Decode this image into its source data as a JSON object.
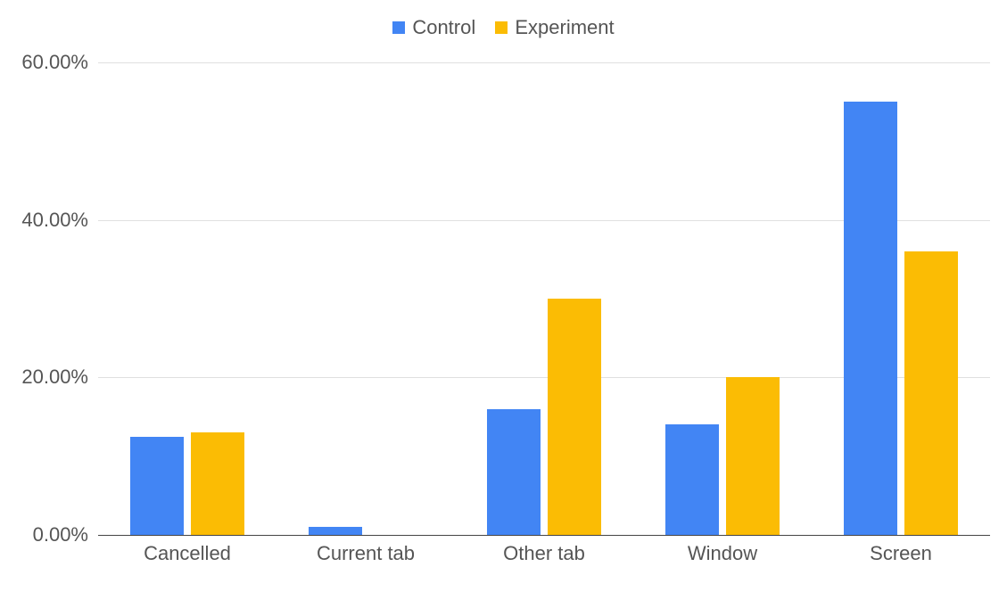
{
  "legend": {
    "items": [
      {
        "name": "Control",
        "color": "#4285f4"
      },
      {
        "name": "Experiment",
        "color": "#fbbc04"
      }
    ]
  },
  "y_ticks": [
    "0.00%",
    "20.00%",
    "40.00%",
    "60.00%"
  ],
  "chart_data": {
    "type": "bar",
    "categories": [
      "Cancelled",
      "Current tab",
      "Other tab",
      "Window",
      "Screen"
    ],
    "series": [
      {
        "name": "Control",
        "color": "#4285f4",
        "values": [
          12.5,
          1.0,
          16.0,
          14.0,
          55.0
        ]
      },
      {
        "name": "Experiment",
        "color": "#fbbc04",
        "values": [
          13.0,
          0.0,
          30.0,
          20.0,
          36.0
        ]
      }
    ],
    "title": "",
    "xlabel": "",
    "ylabel": "",
    "ylim": [
      0,
      60
    ],
    "grid": true,
    "legend_position": "top"
  }
}
